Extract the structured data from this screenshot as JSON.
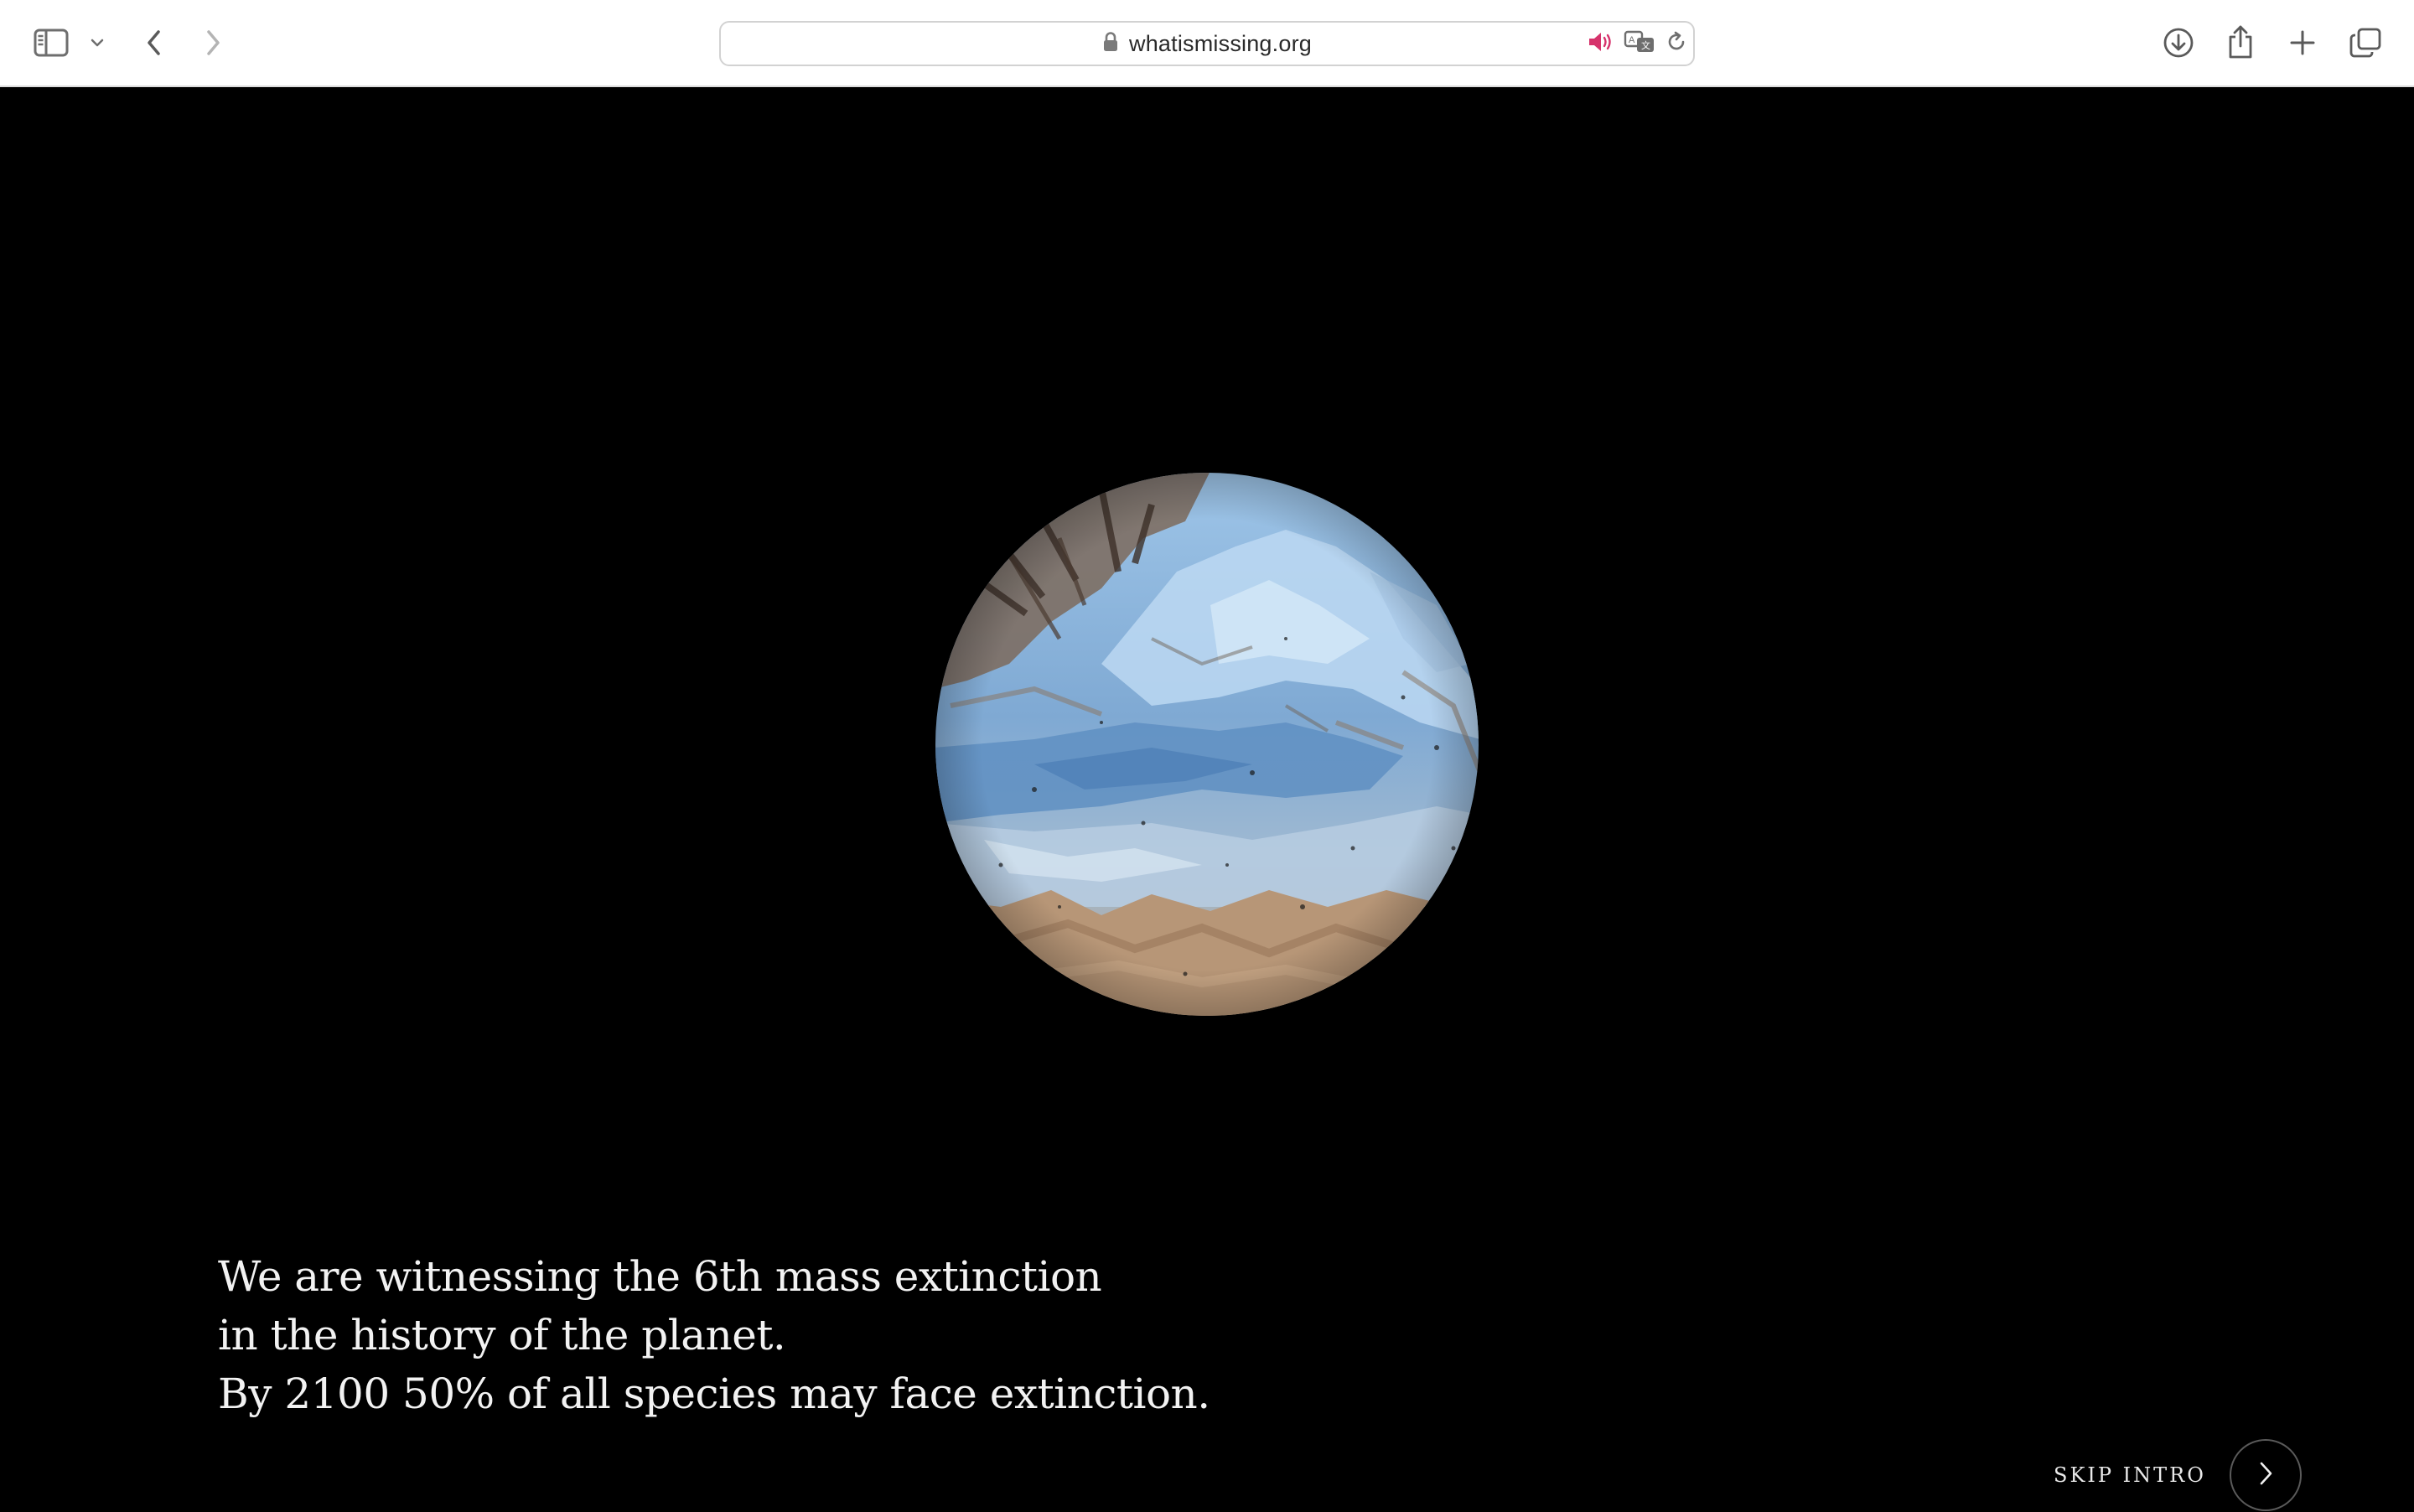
{
  "browser": {
    "url": "whatismissing.org",
    "icons": {
      "sidebar": "sidebar-icon",
      "sidebar_menu": "chevron-down-icon",
      "back": "chevron-left-icon",
      "forward": "chevron-right-icon",
      "lock": "lock-icon",
      "audio": "speaker-icon",
      "translate": "translate-icon",
      "reload": "reload-icon",
      "downloads": "download-icon",
      "share": "share-icon",
      "new_tab": "plus-icon",
      "tab_overview": "tabs-icon"
    },
    "colors": {
      "audio_accent": "#d6336c"
    }
  },
  "page": {
    "image": "planet-glacier-image",
    "intro_lines": [
      "We are witnessing the 6th mass extinction",
      "in the history of the planet.",
      "By 2100 50% of all species may face extinction."
    ],
    "skip_label": "SKIP INTRO",
    "skip_icon": "chevron-right-icon",
    "colors": {
      "background": "#000000",
      "text": "#f2f2f2"
    }
  }
}
